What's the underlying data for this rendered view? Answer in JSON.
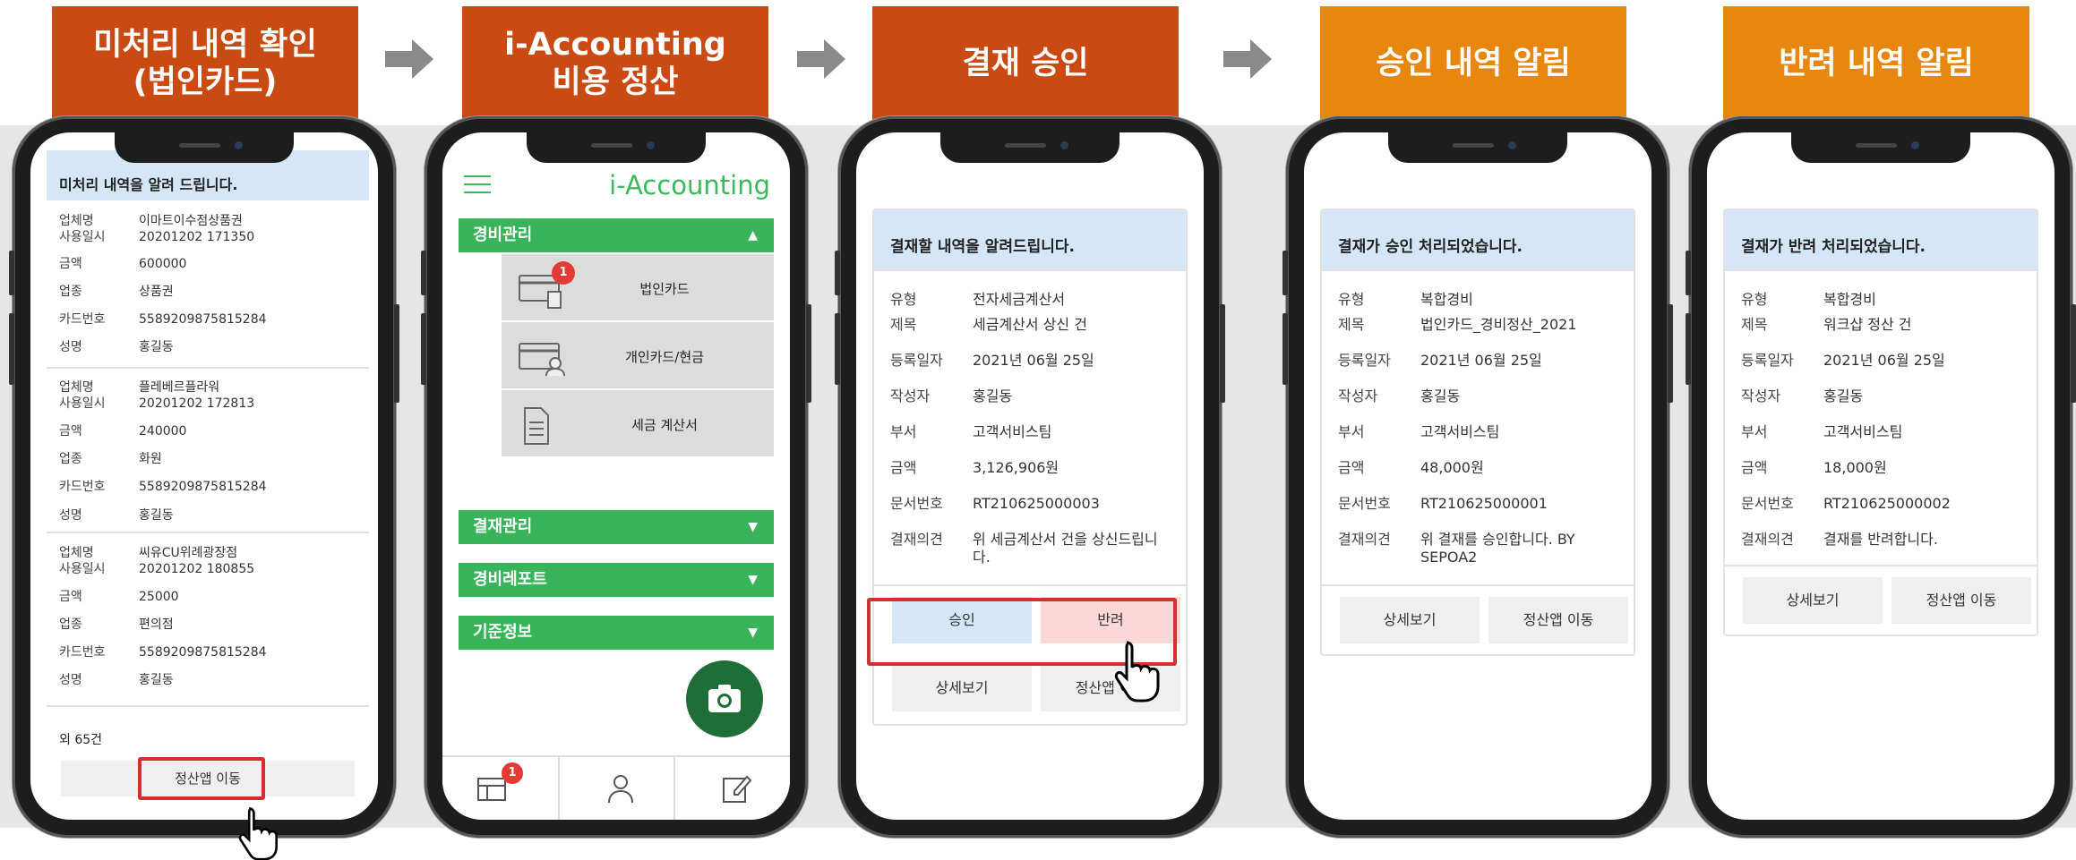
{
  "headers": {
    "h1": "미처리 내역 확인\n(법인카드)",
    "h2": "i-Accounting\n비용 정산",
    "h3": "결재 승인",
    "h4": "승인 내역 알림",
    "h5": "반려 내역 알림"
  },
  "colors": {
    "header_red": "#c94a12",
    "header_orange": "#e8870f",
    "green": "#3ab45a",
    "blue_header": "#d4e6f7",
    "highlight": "#d32f2f"
  },
  "phone1": {
    "banner": "미처리 내역을 알려 드립니다.",
    "records": [
      {
        "vendor_k": "업체명",
        "vendor": "이마트이수점상품권",
        "time_k": "사용일시",
        "time": "20201202 171350",
        "amount_k": "금액",
        "amount": "600000",
        "type_k": "업종",
        "type": "상품권",
        "card_k": "카드번호",
        "card": "5589209875815284",
        "name_k": "성명",
        "name": "홍길동"
      },
      {
        "vendor_k": "업체명",
        "vendor": "플레베르플라워",
        "time_k": "사용일시",
        "time": "20201202 172813",
        "amount_k": "금액",
        "amount": "240000",
        "type_k": "업종",
        "type": "화원",
        "card_k": "카드번호",
        "card": "5589209875815284",
        "name_k": "성명",
        "name": "홍길동"
      },
      {
        "vendor_k": "업체명",
        "vendor": "씨유CU위례광장점",
        "time_k": "사용일시",
        "time": "20201202 180855",
        "amount_k": "금액",
        "amount": "25000",
        "type_k": "업종",
        "type": "편의점",
        "card_k": "카드번호",
        "card": "5589209875815284",
        "name_k": "성명",
        "name": "홍길동"
      }
    ],
    "more": "외 65건",
    "button": "정산앱 이동"
  },
  "phone2": {
    "brand": "i-Accounting",
    "menus": {
      "m1": "경비관리",
      "m2": "결재관리",
      "m3": "경비레포트",
      "m4": "기준정보"
    },
    "subs": {
      "s1": "법인카드",
      "s2": "개인카드/현금",
      "s3": "세금 계산서"
    },
    "badge_card": "1",
    "badge_tab": "1"
  },
  "phone3": {
    "banner": "결재할 내역을 알려드립니다.",
    "rows": {
      "type_k": "유형",
      "type": "전자세금계산서",
      "title_k": "제목",
      "title": "세금계산서 상신 건",
      "date_k": "등록일자",
      "date": "2021년 06월 25일",
      "writer_k": "작성자",
      "writer": "홍길동",
      "dept_k": "부서",
      "dept": "고객서비스팀",
      "amount_k": "금액",
      "amount": "3,126,906원",
      "doc_k": "문서번호",
      "doc": "RT210625000003",
      "opinion_k": "결재의견",
      "opinion": "위 세금계산서 건을 상신드립니다."
    },
    "approve": "승인",
    "reject": "반려",
    "detail": "상세보기",
    "goapp": "정산앱 이동"
  },
  "phone4": {
    "banner": "결재가 승인 처리되었습니다.",
    "rows": {
      "type_k": "유형",
      "type": "복합경비",
      "title_k": "제목",
      "title": "법인카드_경비정산_2021",
      "date_k": "등록일자",
      "date": "2021년 06월 25일",
      "writer_k": "작성자",
      "writer": "홍길동",
      "dept_k": "부서",
      "dept": "고객서비스팀",
      "amount_k": "금액",
      "amount": "48,000원",
      "doc_k": "문서번호",
      "doc": "RT210625000001",
      "opinion_k": "결재의견",
      "opinion": "위 결재를 승인합니다. BY SEPOA2"
    },
    "detail": "상세보기",
    "goapp": "정산앱 이동"
  },
  "phone5": {
    "banner": "결재가 반려 처리되었습니다.",
    "rows": {
      "type_k": "유형",
      "type": "복합경비",
      "title_k": "제목",
      "title": "워크샵 정산 건",
      "date_k": "등록일자",
      "date": "2021년 06월 25일",
      "writer_k": "작성자",
      "writer": "홍길동",
      "dept_k": "부서",
      "dept": "고객서비스팀",
      "amount_k": "금액",
      "amount": "18,000원",
      "doc_k": "문서번호",
      "doc": "RT210625000002",
      "opinion_k": "결재의견",
      "opinion": "결재를 반려합니다."
    },
    "detail": "상세보기",
    "goapp": "정산앱 이동"
  }
}
